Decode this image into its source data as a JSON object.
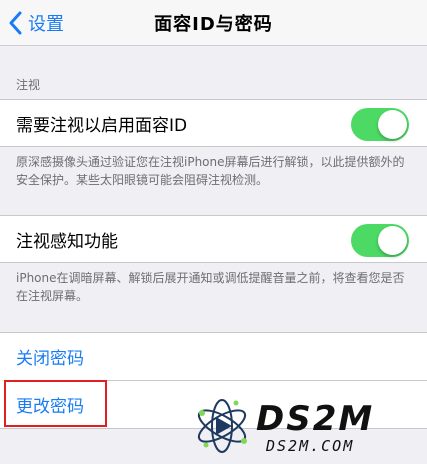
{
  "nav": {
    "back_label": "设置",
    "title": "面容ID与密码"
  },
  "attention_section": {
    "header": "注视",
    "require_attention": {
      "label": "需要注视以启用面容ID",
      "enabled": true
    },
    "require_attention_footer": "原深感摄像头通过验证您在注视iPhone屏幕后进行解锁，以此提供额外的安全保护。某些太阳眼镜可能会阻碍注视检测。",
    "attention_aware": {
      "label": "注视感知功能",
      "enabled": true
    },
    "attention_aware_footer": "iPhone在调暗屏幕、解锁后展开通知或调低提醒音量之前，将查看您是否在注视屏幕。"
  },
  "passcode_section": {
    "turn_off": "关闭密码",
    "change": "更改密码"
  },
  "watermark": {
    "brand": "DS2M",
    "domain": "DS2M.COM"
  },
  "colors": {
    "accent": "#1a7cf5",
    "toggle_on": "#4cd964",
    "highlight": "#e02020"
  }
}
